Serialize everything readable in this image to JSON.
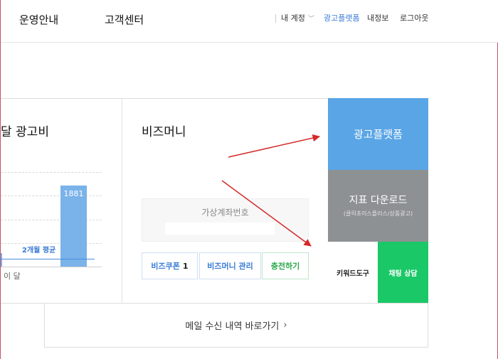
{
  "header": {
    "nav": [
      "운영안내",
      "고객센터"
    ],
    "util": {
      "account": "내 계정",
      "ad_platform": "광고플랫폼",
      "my_info": "내정보",
      "logout": "로그아웃"
    }
  },
  "ad_cost": {
    "title": "달 광고비",
    "bar_value": "1881",
    "avg_label": "2개월 평균",
    "x_label": "이 달"
  },
  "chart_data": {
    "type": "bar",
    "categories": [
      "",
      "이 달"
    ],
    "values": [
      null,
      1881
    ],
    "title": "달 광고비",
    "xlabel": "",
    "ylabel": "",
    "ylim": [
      0,
      2200
    ],
    "grid": true,
    "reference_line": {
      "label": "2개월 평균"
    }
  },
  "bizmoney": {
    "title": "비즈머니",
    "virtual_account_label": "가상계좌번호",
    "coupon_label": "비즈쿠폰",
    "coupon_count": "1",
    "manage_label": "비즈머니 관리",
    "charge_label": "충전하기"
  },
  "tiles": {
    "ad_platform": "광고플랫폼",
    "download_title": "지표 다운로드",
    "download_sub": "(클릭초이스플러스/상품광고)",
    "keyword_tool": "키워드도구",
    "chat_consult": "채팅 상담"
  },
  "mail": {
    "label": "메일 수신 내역 바로가기",
    "arrow": "›"
  },
  "colors": {
    "accent_blue": "#5aa5e6",
    "bar_blue": "#7ab2ea",
    "green": "#1bc867",
    "gray_tile": "#8e9193",
    "annotation_red": "#d42a2a"
  }
}
